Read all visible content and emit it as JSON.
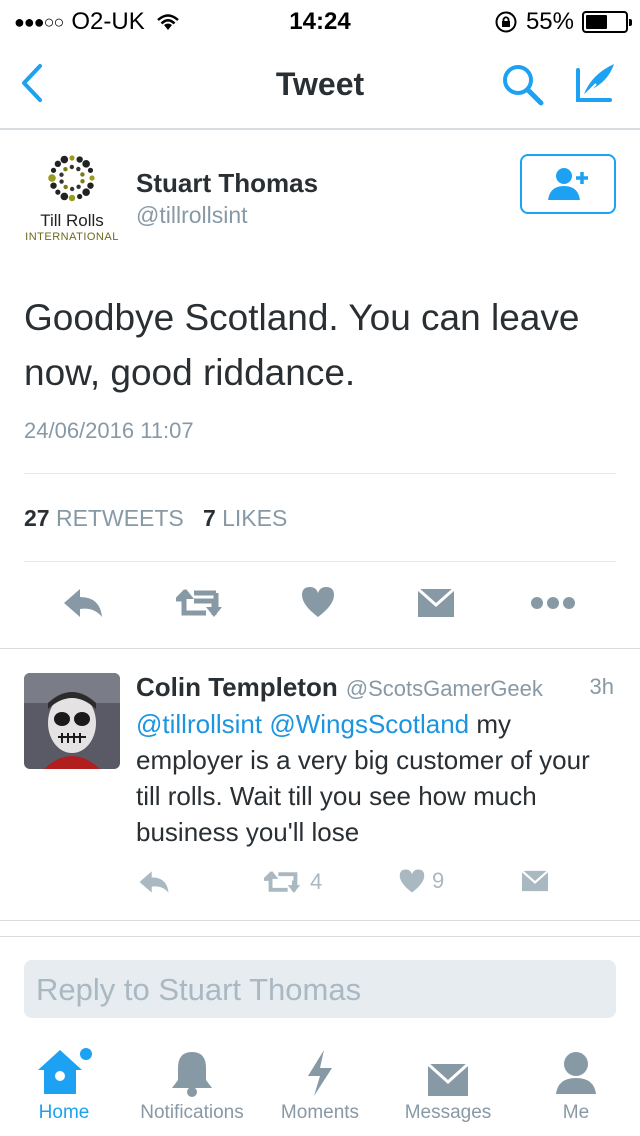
{
  "status_bar": {
    "carrier": "O2-UK",
    "time": "14:24",
    "battery": "55%",
    "battery_level": 0.55
  },
  "nav": {
    "title": "Tweet"
  },
  "tweet": {
    "logo_name": "Till Rolls",
    "logo_sub": "INTERNATIONAL",
    "author": "Stuart Thomas",
    "handle": "@tillrollsint",
    "text": "Goodbye Scotland. You can leave now, good riddance.",
    "date": "24/06/2016 11:07",
    "retweets_count": "27",
    "retweets_label": "RETWEETS",
    "likes_count": "7",
    "likes_label": "LIKES"
  },
  "reply": {
    "author": "Colin Templeton",
    "handle": "@ScotsGamerGeek",
    "time": "3h",
    "mention1": "@tillrollsint",
    "mention2": "@WingsScotland",
    "text": " my employer is a very big customer of your till rolls. Wait till you see how much business you'll lose",
    "retweets": "4",
    "likes": "9"
  },
  "composer": {
    "placeholder": "Reply to Stuart Thomas"
  },
  "tabs": [
    {
      "label": "Home",
      "icon": "home-icon",
      "active": true
    },
    {
      "label": "Notifications",
      "icon": "bell-icon",
      "active": false
    },
    {
      "label": "Moments",
      "icon": "lightning-icon",
      "active": false
    },
    {
      "label": "Messages",
      "icon": "envelope-icon",
      "active": false
    },
    {
      "label": "Me",
      "icon": "person-icon",
      "active": false
    }
  ],
  "colors": {
    "accent": "#1da1f2",
    "muted": "#8899a6",
    "icon_gray": "#8899a6"
  }
}
